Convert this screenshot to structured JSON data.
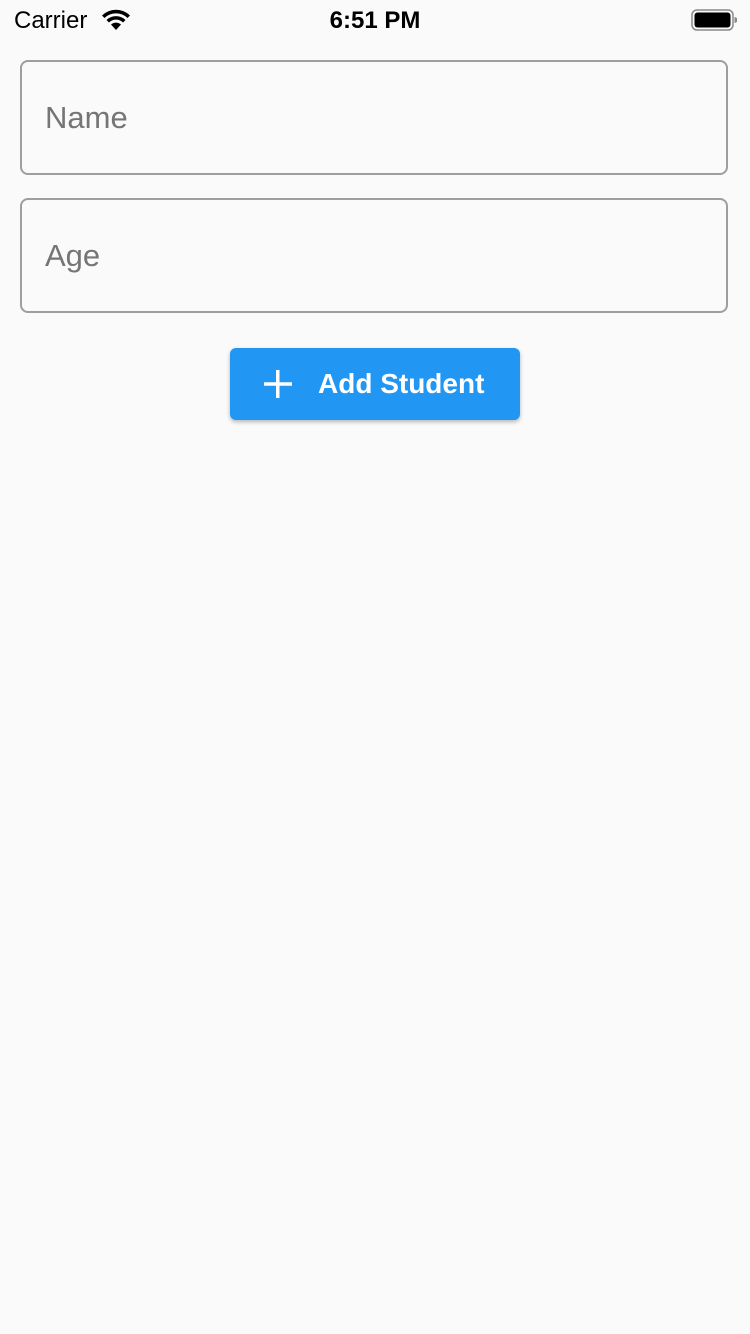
{
  "status_bar": {
    "carrier": "Carrier",
    "time": "6:51 PM",
    "wifi_icon": "wifi-icon",
    "battery_icon": "battery-full-icon"
  },
  "form": {
    "name_field": {
      "placeholder": "Name",
      "value": ""
    },
    "age_field": {
      "placeholder": "Age",
      "value": ""
    },
    "add_button": {
      "label": "Add Student",
      "icon": "plus-icon",
      "color": "#2196f3"
    }
  },
  "colors": {
    "background": "#fafafa",
    "field_border": "#9e9e9e",
    "placeholder": "#757575",
    "button_text": "#ffffff"
  }
}
